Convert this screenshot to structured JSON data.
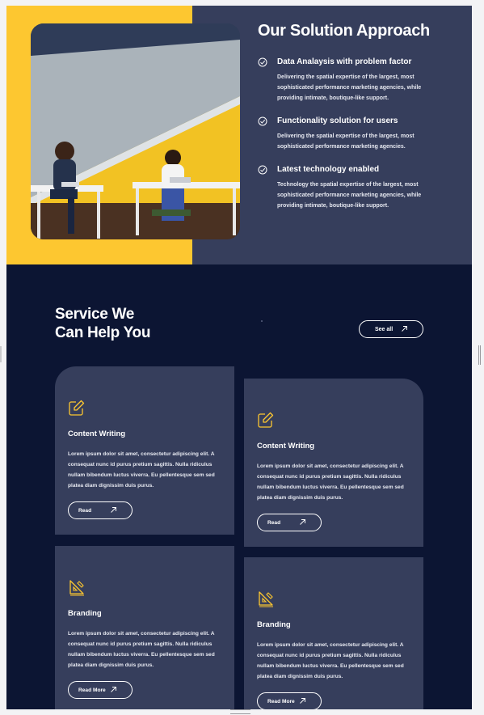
{
  "solution": {
    "title": "Our Solution Approach",
    "points": [
      {
        "title": "Data Analaysis with problem factor",
        "desc": "Delivering the spatial expertise of the largest, most sophisticated performance marketing agencies, while providing intimate, boutique-like support."
      },
      {
        "title": "Functionality solution for users",
        "desc": "Delivering the spatial expertise of the largest, most sophisticated performance marketing agencies."
      },
      {
        "title": "Latest technology enabled",
        "desc": "Technology the spatial expertise of the largest, most sophisticated performance marketing agencies, while providing intimate, boutique-like support."
      }
    ]
  },
  "services": {
    "title_line1": "Service We",
    "title_line2": "Can Help You",
    "see_all": "See all",
    "cards": [
      {
        "icon": "edit-icon",
        "title": "Content Writing",
        "desc": "Lorem ipsum dolor sit amet, consectetur adipiscing elit. A consequat nunc id purus pretium sagittis. Nulla ridiculus nullam bibendum luctus viverra. Eu pellentesque sem sed platea diam dignissim duis purus.",
        "button": "Read"
      },
      {
        "icon": "edit-icon",
        "title": "Content Writing",
        "desc": "Lorem ipsum dolor sit amet, consectetur adipiscing elit. A consequat nunc id purus pretium sagittis. Nulla ridiculus nullam bibendum luctus viverra. Eu pellentesque sem sed platea diam dignissim duis purus.",
        "button": "Read"
      },
      {
        "icon": "design-tools-icon",
        "title": "Branding",
        "desc": "Lorem ipsum dolor sit amet, consectetur adipiscing elit. A consequat nunc id purus pretium sagittis. Nulla ridiculus nullam bibendum luctus viverra. Eu pellentesque sem sed platea diam dignissim duis purus.",
        "button": "Read More"
      },
      {
        "icon": "design-tools-icon",
        "title": "Branding",
        "desc": "Lorem ipsum dolor sit amet, consectetur adipiscing elit. A consequat nunc id purus pretium sagittis. Nulla ridiculus nullam bibendum luctus viverra. Eu pellentesque sem sed platea diam dignissim duis purus.",
        "button": "Read More"
      }
    ]
  },
  "colors": {
    "accent": "#fdc730",
    "panel": "#363e5c",
    "dark": "#0c1533"
  }
}
